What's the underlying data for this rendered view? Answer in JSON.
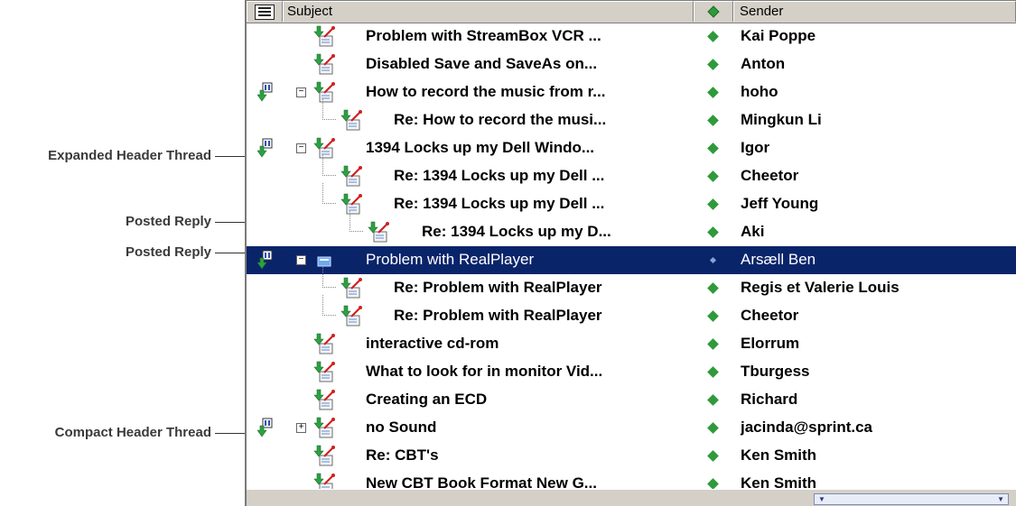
{
  "callouts": {
    "expanded": "Expanded Header Thread",
    "posted_reply_1": "Posted Reply",
    "posted_reply_2": "Posted Reply",
    "compact": "Compact Header Thread"
  },
  "columns": {
    "subject": "Subject",
    "sender": "Sender"
  },
  "messages": [
    {
      "subject": "Problem with StreamBox VCR ...",
      "sender": "Kai Poppe"
    },
    {
      "subject": "Disabled Save and SaveAs on...",
      "sender": "Anton"
    },
    {
      "subject": "How to record the music from r...",
      "sender": "hoho"
    },
    {
      "subject": "Re: How to record the musi...",
      "sender": "Mingkun Li"
    },
    {
      "subject": "1394 Locks up my Dell Windo...",
      "sender": "Igor"
    },
    {
      "subject": "Re: 1394 Locks up my Dell ...",
      "sender": "Cheetor"
    },
    {
      "subject": "Re: 1394 Locks up my Dell ...",
      "sender": "Jeff Young"
    },
    {
      "subject": "Re: 1394 Locks up my D...",
      "sender": "Aki"
    },
    {
      "subject": "Problem with RealPlayer",
      "sender": "Arsæll Ben"
    },
    {
      "subject": "Re: Problem with RealPlayer",
      "sender": "Regis et Valerie Louis"
    },
    {
      "subject": "Re: Problem with RealPlayer",
      "sender": "Cheetor"
    },
    {
      "subject": "interactive cd-rom",
      "sender": "Elorrum"
    },
    {
      "subject": "What to look for in monitor Vid...",
      "sender": "Tburgess"
    },
    {
      "subject": "Creating an ECD",
      "sender": "Richard"
    },
    {
      "subject": "no Sound",
      "sender": "jacinda@sprint.ca"
    },
    {
      "subject": "Re: CBT's",
      "sender": "Ken Smith"
    },
    {
      "subject": "New CBT Book Format New G...",
      "sender": "Ken Smith"
    }
  ],
  "expanders": {
    "expanded": "−",
    "collapsed": "+"
  },
  "colors": {
    "selection": "#0a246a",
    "sender_status": "#2e9a3a",
    "chrome": "#d4d0c8"
  },
  "icons": {
    "thread": "thread-header-icon",
    "message": "news-message-icon",
    "sender_status": "online-diamond-icon"
  }
}
